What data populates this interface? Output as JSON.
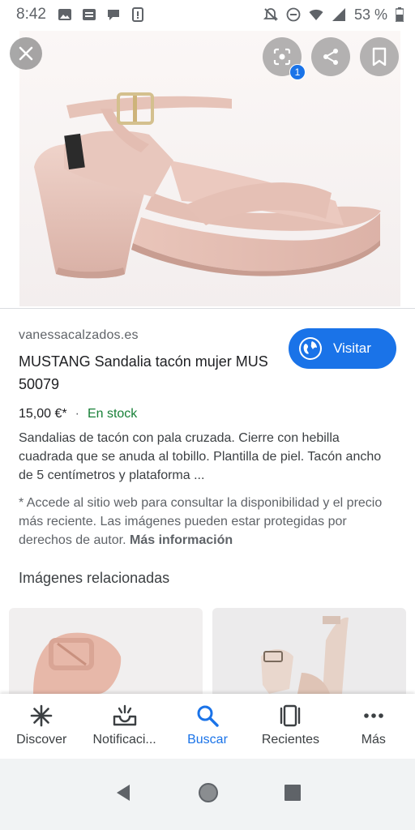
{
  "status_bar": {
    "time": "8:42",
    "battery": "53 %"
  },
  "result": {
    "source": "vanessacalzados.es",
    "title": "MUSTANG Sandalia tacón mujer MUS 50079",
    "visit_label": "Visitar",
    "price": "15,00 €*",
    "price_separator": "·",
    "stock": "En stock",
    "description": "Sandalias de tacón con pala cruzada. Cierre con hebilla cuadrada que se anuda al tobillo. Plantilla de piel. Tacón ancho de 5 centímetros y plataforma ...",
    "note": "* Accede al sitio web para consultar la disponibilidad y el precio más reciente. Las imágenes pueden estar protegidas por derechos de autor.",
    "note_link": "Más información",
    "lens_badge": "1"
  },
  "related": {
    "title": "Imágenes relacionadas"
  },
  "bottom_nav": {
    "items": [
      {
        "label": "Discover",
        "icon": "asterisk-icon"
      },
      {
        "label": "Notificaci...",
        "icon": "bell-tray-icon"
      },
      {
        "label": "Buscar",
        "icon": "search-icon"
      },
      {
        "label": "Recientes",
        "icon": "recent-cards-icon"
      },
      {
        "label": "Más",
        "icon": "more-dots-icon"
      }
    ]
  },
  "colors": {
    "accent": "#1a73e8",
    "stock_green": "#188038",
    "shoe_pink": "#e8c6bd"
  }
}
